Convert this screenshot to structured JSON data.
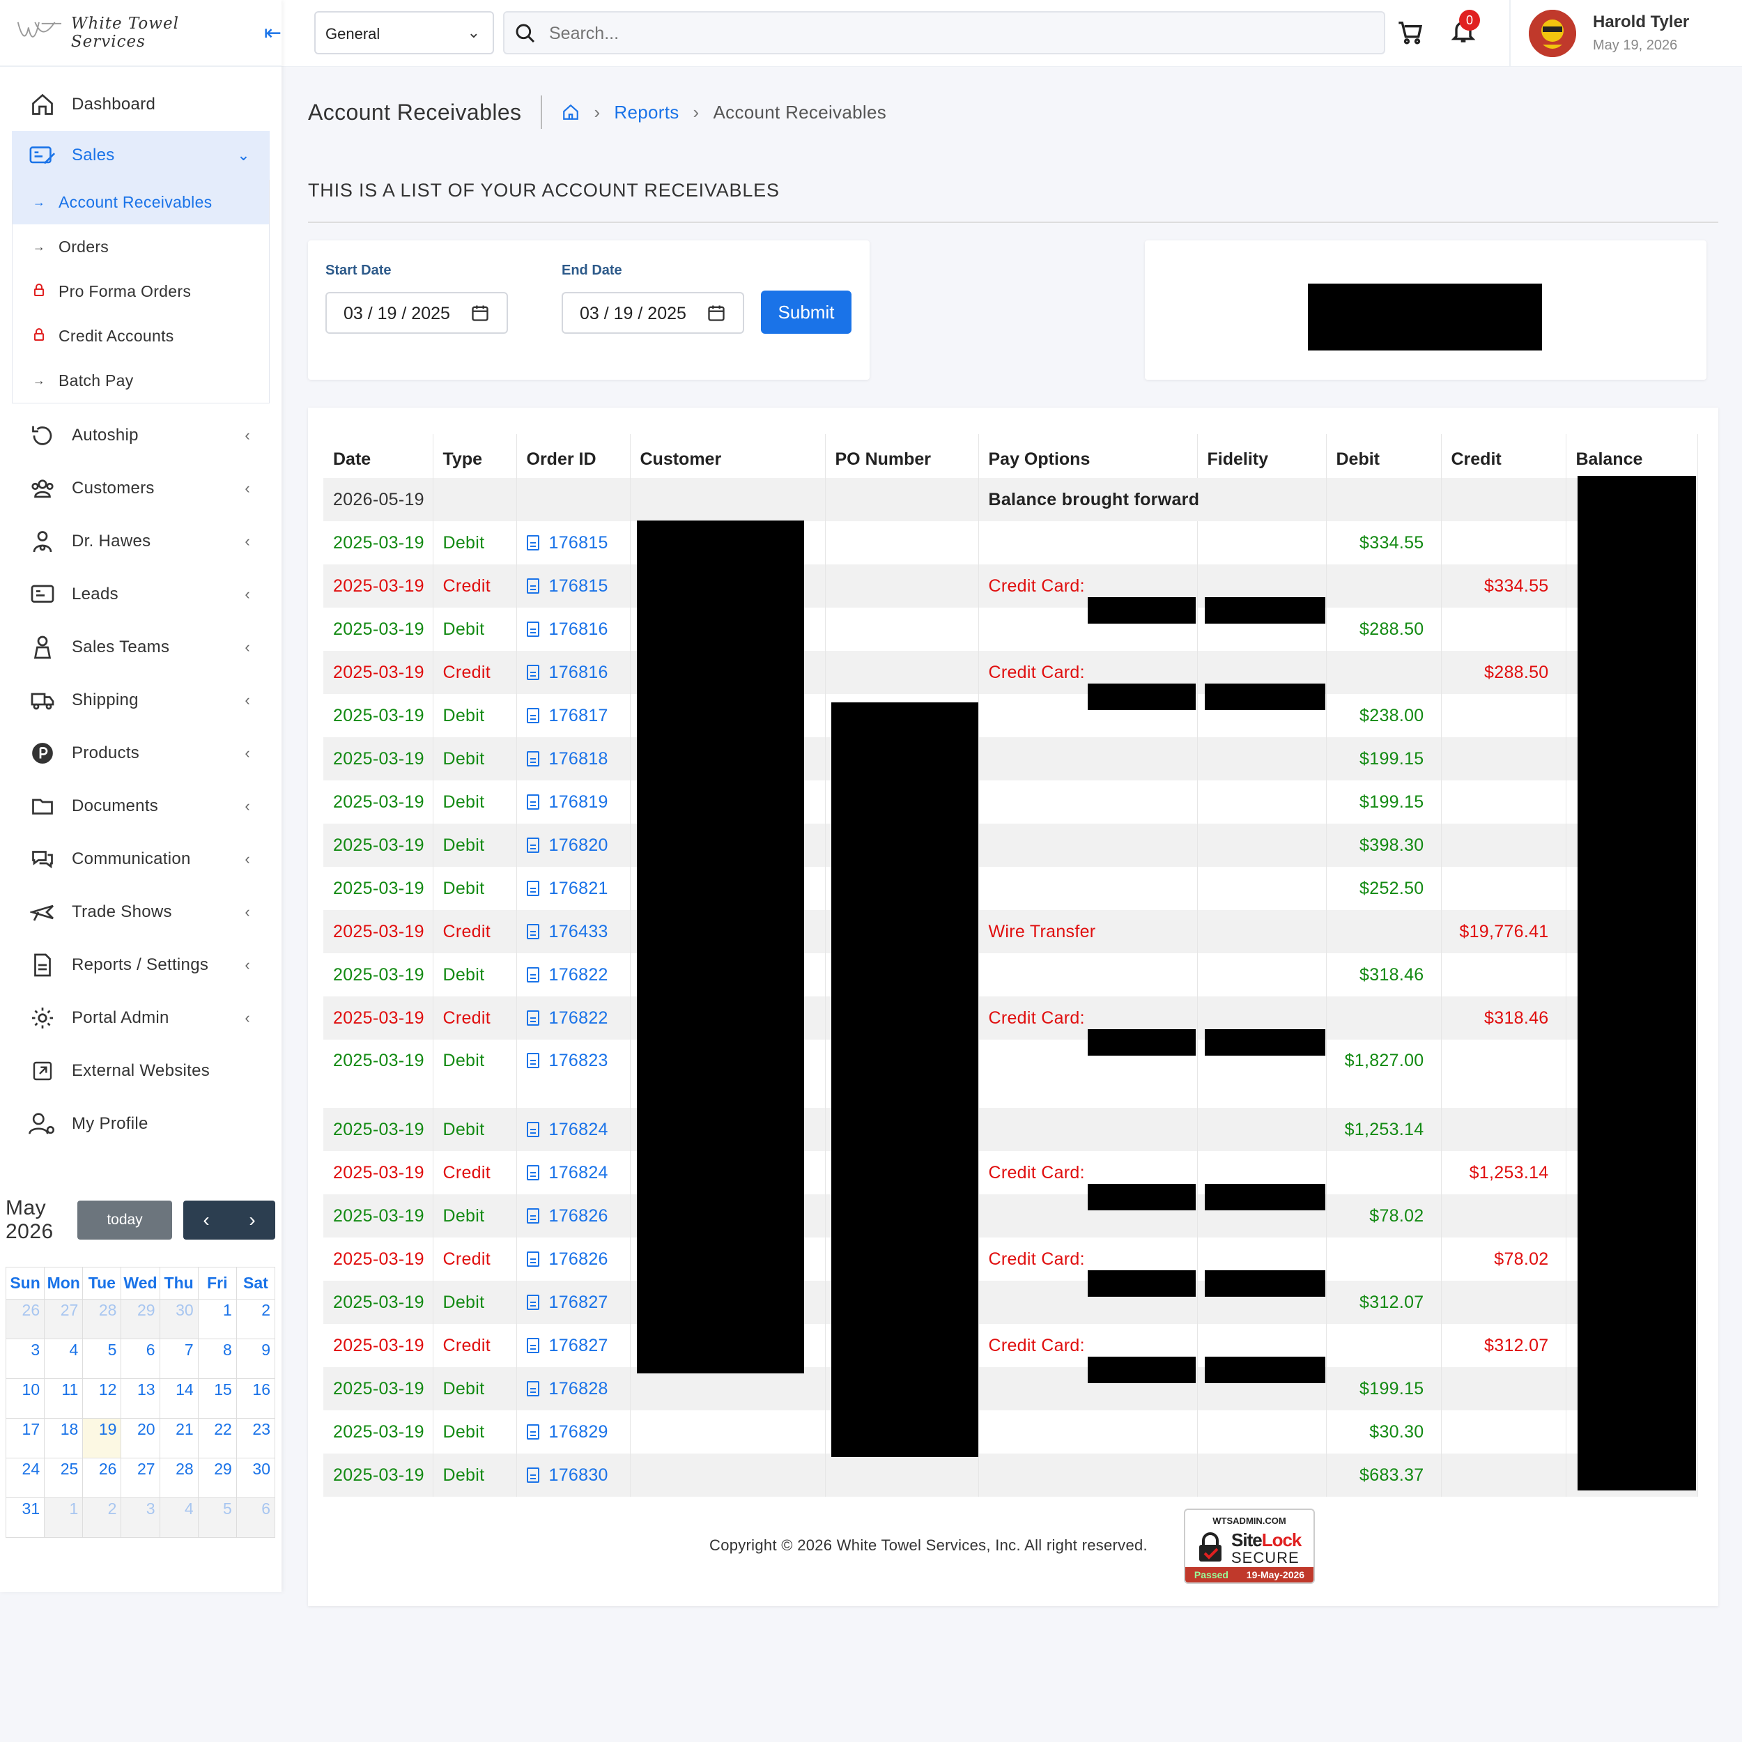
{
  "brand": {
    "name": "White Towel Services"
  },
  "topbar": {
    "select_value": "General",
    "search_placeholder": "Search...",
    "notif_count": "0",
    "user_name": "Harold Tyler",
    "user_date": "May 19, 2026"
  },
  "sidebar": {
    "dashboard": "Dashboard",
    "sales": "Sales",
    "sales_sub": [
      "Account Receivables",
      "Orders",
      "Pro Forma Orders",
      "Credit Accounts",
      "Batch Pay"
    ],
    "items": [
      {
        "label": "Autoship",
        "icon": "refresh-icon"
      },
      {
        "label": "Customers",
        "icon": "users-icon"
      },
      {
        "label": "Dr. Hawes",
        "icon": "doctor-icon"
      },
      {
        "label": "Leads",
        "icon": "leads-icon"
      },
      {
        "label": "Sales Teams",
        "icon": "team-icon"
      },
      {
        "label": "Shipping",
        "icon": "truck-icon"
      },
      {
        "label": "Products",
        "icon": "products-icon"
      },
      {
        "label": "Documents",
        "icon": "folder-icon"
      },
      {
        "label": "Communication",
        "icon": "chat-icon"
      },
      {
        "label": "Trade Shows",
        "icon": "plane-icon"
      },
      {
        "label": "Reports / Settings",
        "icon": "report-icon"
      },
      {
        "label": "Portal Admin",
        "icon": "gear-icon"
      }
    ],
    "external": "External Websites",
    "profile": "My Profile"
  },
  "calendar": {
    "title": "May 2026",
    "today_label": "today",
    "days": [
      "Sun",
      "Mon",
      "Tue",
      "Wed",
      "Thu",
      "Fri",
      "Sat"
    ],
    "weeks": [
      [
        [
          "26",
          1
        ],
        [
          "27",
          1
        ],
        [
          "28",
          1
        ],
        [
          "29",
          1
        ],
        [
          "30",
          1
        ],
        [
          "1",
          0
        ],
        [
          "2",
          0
        ]
      ],
      [
        [
          "3",
          0
        ],
        [
          "4",
          0
        ],
        [
          "5",
          0
        ],
        [
          "6",
          0
        ],
        [
          "7",
          0
        ],
        [
          "8",
          0
        ],
        [
          "9",
          0
        ]
      ],
      [
        [
          "10",
          0
        ],
        [
          "11",
          0
        ],
        [
          "12",
          0
        ],
        [
          "13",
          0
        ],
        [
          "14",
          0
        ],
        [
          "15",
          0
        ],
        [
          "16",
          0
        ]
      ],
      [
        [
          "17",
          0
        ],
        [
          "18",
          0
        ],
        [
          "19",
          2
        ],
        [
          "20",
          0
        ],
        [
          "21",
          0
        ],
        [
          "22",
          0
        ],
        [
          "23",
          0
        ]
      ],
      [
        [
          "24",
          0
        ],
        [
          "25",
          0
        ],
        [
          "26",
          0
        ],
        [
          "27",
          0
        ],
        [
          "28",
          0
        ],
        [
          "29",
          0
        ],
        [
          "30",
          0
        ]
      ],
      [
        [
          "31",
          0
        ],
        [
          "1",
          1
        ],
        [
          "2",
          1
        ],
        [
          "3",
          1
        ],
        [
          "4",
          1
        ],
        [
          "5",
          1
        ],
        [
          "6",
          1
        ]
      ]
    ]
  },
  "page": {
    "title": "Account Receivables",
    "breadcrumb_reports": "Reports",
    "breadcrumb_current": "Account Receivables",
    "subtitle": "THIS IS A LIST OF YOUR ACCOUNT RECEIVABLES",
    "start_label": "Start Date",
    "end_label": "End Date",
    "start_value": "03 / 19 / 2025",
    "end_value": "03 / 19 / 2025",
    "submit": "Submit"
  },
  "table": {
    "headers": [
      "Date",
      "Type",
      "Order ID",
      "Customer",
      "PO Number",
      "Pay Options",
      "Fidelity",
      "Debit",
      "Credit",
      "Balance"
    ],
    "bbf_date": "2026-05-19",
    "bbf_label": "Balance brought forward",
    "rows": [
      {
        "date": "2025-03-19",
        "type": "Debit",
        "oid": "176815",
        "pay": "",
        "debit": "$334.55",
        "credit": ""
      },
      {
        "date": "2025-03-19",
        "type": "Credit",
        "oid": "176815",
        "pay": "Credit Card:",
        "debit": "",
        "credit": "$334.55"
      },
      {
        "date": "2025-03-19",
        "type": "Debit",
        "oid": "176816",
        "pay": "",
        "debit": "$288.50",
        "credit": ""
      },
      {
        "date": "2025-03-19",
        "type": "Credit",
        "oid": "176816",
        "pay": "Credit Card:",
        "debit": "",
        "credit": "$288.50"
      },
      {
        "date": "2025-03-19",
        "type": "Debit",
        "oid": "176817",
        "pay": "",
        "debit": "$238.00",
        "credit": ""
      },
      {
        "date": "2025-03-19",
        "type": "Debit",
        "oid": "176818",
        "pay": "",
        "debit": "$199.15",
        "credit": ""
      },
      {
        "date": "2025-03-19",
        "type": "Debit",
        "oid": "176819",
        "pay": "",
        "debit": "$199.15",
        "credit": ""
      },
      {
        "date": "2025-03-19",
        "type": "Debit",
        "oid": "176820",
        "pay": "",
        "debit": "$398.30",
        "credit": ""
      },
      {
        "date": "2025-03-19",
        "type": "Debit",
        "oid": "176821",
        "pay": "",
        "debit": "$252.50",
        "credit": ""
      },
      {
        "date": "2025-03-19",
        "type": "Credit",
        "oid": "176433",
        "pay": "Wire Transfer",
        "debit": "",
        "credit": "$19,776.41"
      },
      {
        "date": "2025-03-19",
        "type": "Debit",
        "oid": "176822",
        "pay": "",
        "debit": "$318.46",
        "credit": ""
      },
      {
        "date": "2025-03-19",
        "type": "Credit",
        "oid": "176822",
        "pay": "Credit Card:",
        "debit": "",
        "credit": "$318.46"
      },
      {
        "date": "2025-03-19",
        "type": "Debit",
        "oid": "176823",
        "pay": "",
        "debit": "$1,827.00",
        "credit": "",
        "tall": true
      },
      {
        "date": "2025-03-19",
        "type": "Debit",
        "oid": "176824",
        "pay": "",
        "debit": "$1,253.14",
        "credit": ""
      },
      {
        "date": "2025-03-19",
        "type": "Credit",
        "oid": "176824",
        "pay": "Credit Card:",
        "debit": "",
        "credit": "$1,253.14"
      },
      {
        "date": "2025-03-19",
        "type": "Debit",
        "oid": "176826",
        "pay": "",
        "debit": "$78.02",
        "credit": ""
      },
      {
        "date": "2025-03-19",
        "type": "Credit",
        "oid": "176826",
        "pay": "Credit Card:",
        "debit": "",
        "credit": "$78.02"
      },
      {
        "date": "2025-03-19",
        "type": "Debit",
        "oid": "176827",
        "pay": "",
        "debit": "$312.07",
        "credit": ""
      },
      {
        "date": "2025-03-19",
        "type": "Credit",
        "oid": "176827",
        "pay": "Credit Card:",
        "debit": "",
        "credit": "$312.07"
      },
      {
        "date": "2025-03-19",
        "type": "Debit",
        "oid": "176828",
        "pay": "",
        "debit": "$199.15",
        "credit": ""
      },
      {
        "date": "2025-03-19",
        "type": "Debit",
        "oid": "176829",
        "pay": "",
        "debit": "$30.30",
        "credit": ""
      },
      {
        "date": "2025-03-19",
        "type": "Debit",
        "oid": "176830",
        "pay": "",
        "debit": "$683.37",
        "credit": ""
      }
    ]
  },
  "footer": {
    "copyright": "Copyright © 2026 White Towel Services, Inc. All right reserved.",
    "sitelock_domain": "WTSADMIN.COM",
    "sitelock_brand_a": "Site",
    "sitelock_brand_b": "Lock",
    "sitelock_secure": "SECURE",
    "sitelock_passed": "Passed",
    "sitelock_date": "19-May-2026"
  },
  "colors": {
    "accent": "#1a73e8",
    "debit": "#138a13",
    "credit": "#e00e0e",
    "badge": "#e02020"
  }
}
